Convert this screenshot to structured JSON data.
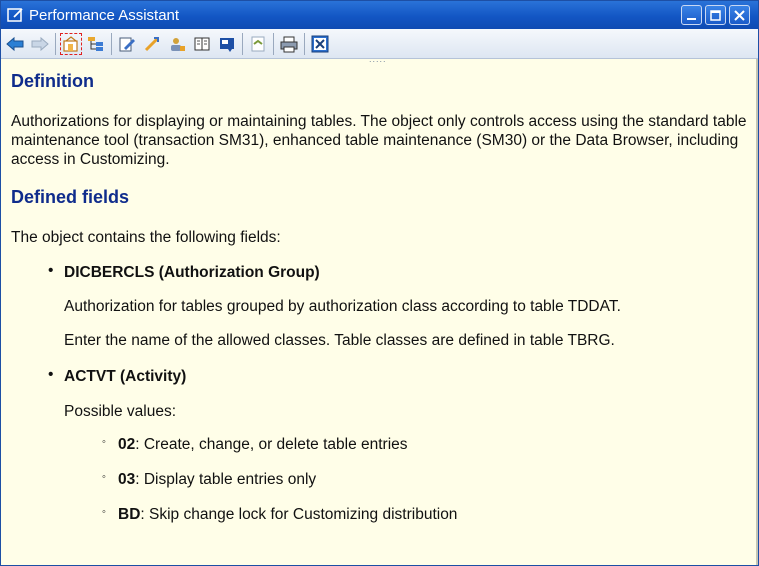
{
  "window": {
    "title": "Performance Assistant",
    "controls": [
      "minimize-icon",
      "maximize-icon",
      "close-icon"
    ]
  },
  "toolbar": {
    "buttons": [
      {
        "name": "back-icon"
      },
      {
        "name": "forward-icon"
      },
      {
        "name": "technical-info-icon",
        "active": true
      },
      {
        "name": "structure-icon"
      },
      {
        "name": "edit-icon"
      },
      {
        "name": "link-icon"
      },
      {
        "name": "user-icon"
      },
      {
        "name": "book-icon"
      },
      {
        "name": "glossary-icon"
      },
      {
        "name": "favorites-icon"
      },
      {
        "name": "print-icon"
      },
      {
        "name": "close-help-icon"
      }
    ]
  },
  "content": {
    "definition_heading": "Definition",
    "definition_text": "Authorizations for displaying or maintaining tables. The object only controls access using the standard table maintenance tool (transaction SM31), enhanced table maintenance (SM30) or the Data Browser, including access in Customizing.",
    "fields_heading": "Defined fields",
    "fields_intro": "The object contains the following fields:",
    "field1": {
      "bullet": "•",
      "name": "DICBERCLS (Authorization Group)",
      "desc1": "Authorization for tables grouped by authorization class according to table TDDAT.",
      "desc2": "Enter the name of the allowed classes. Table classes are defined in table TBRG."
    },
    "field2": {
      "bullet": "•",
      "name": "ACTVT (Activity)",
      "intro": "Possible values:",
      "values": [
        {
          "marker": "◦",
          "code": "02",
          "text": ": Create, change, or delete table entries"
        },
        {
          "marker": "◦",
          "code": "03",
          "text": ": Display table entries only"
        },
        {
          "marker": "◦",
          "code": "BD",
          "text": ": Skip change lock for Customizing distribution"
        }
      ]
    }
  }
}
